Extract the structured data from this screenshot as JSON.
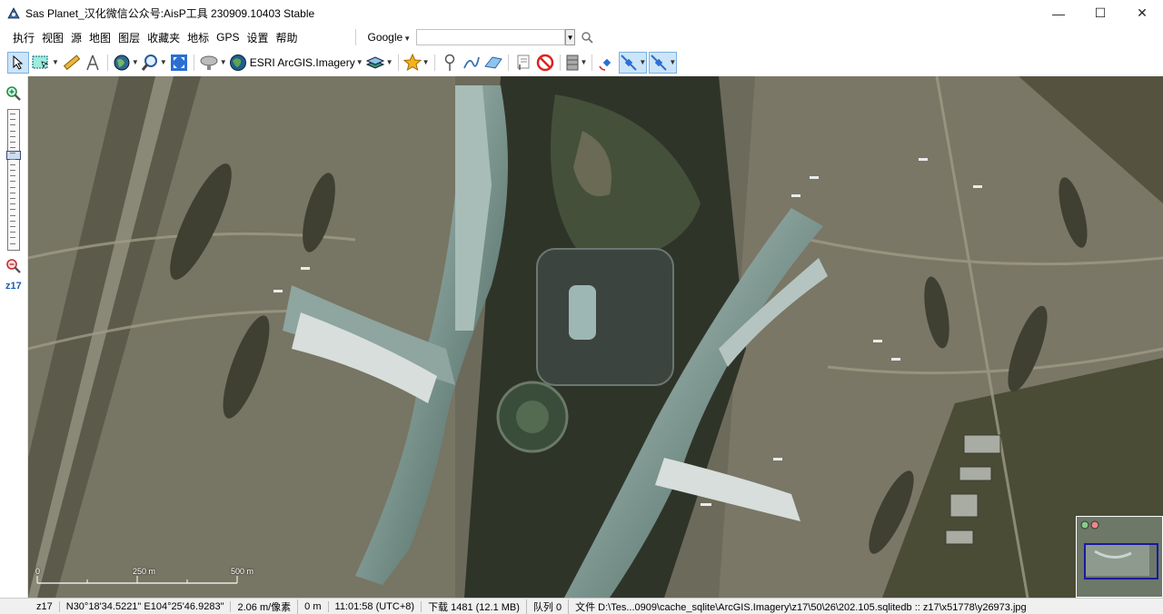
{
  "window": {
    "title": "Sas Planet_汉化微信公众号:AisP工具 230909.10403 Stable",
    "controls": [
      "—",
      "☐",
      "✕"
    ]
  },
  "menu": {
    "items": [
      "执行",
      "视图",
      "源",
      "地图",
      "图层",
      "收藏夹",
      "地标",
      "GPS",
      "设置",
      "帮助"
    ],
    "search_provider": "Google"
  },
  "toolbar": {
    "map_source": "ESRI ArcGIS.Imagery"
  },
  "left_panel": {
    "zoom_label": "z17"
  },
  "map": {
    "scale_labels": [
      "0",
      "250 m",
      "500 m"
    ]
  },
  "status": {
    "zoom": "z17",
    "coords": "N30°18'34.5221\" E104°25'46.9283\"",
    "resolution": "2.06 m/像素",
    "distance": "0 m",
    "time": "11:01:58 (UTC+8)",
    "download": "下载 1481 (12.1 MB)",
    "queue": "队列 0",
    "file": "文件 D:\\Tes...0909\\cache_sqlite\\ArcGIS.Imagery\\z17\\50\\26\\202.105.sqlitedb :: z17\\x51778\\y26973.jpg"
  }
}
